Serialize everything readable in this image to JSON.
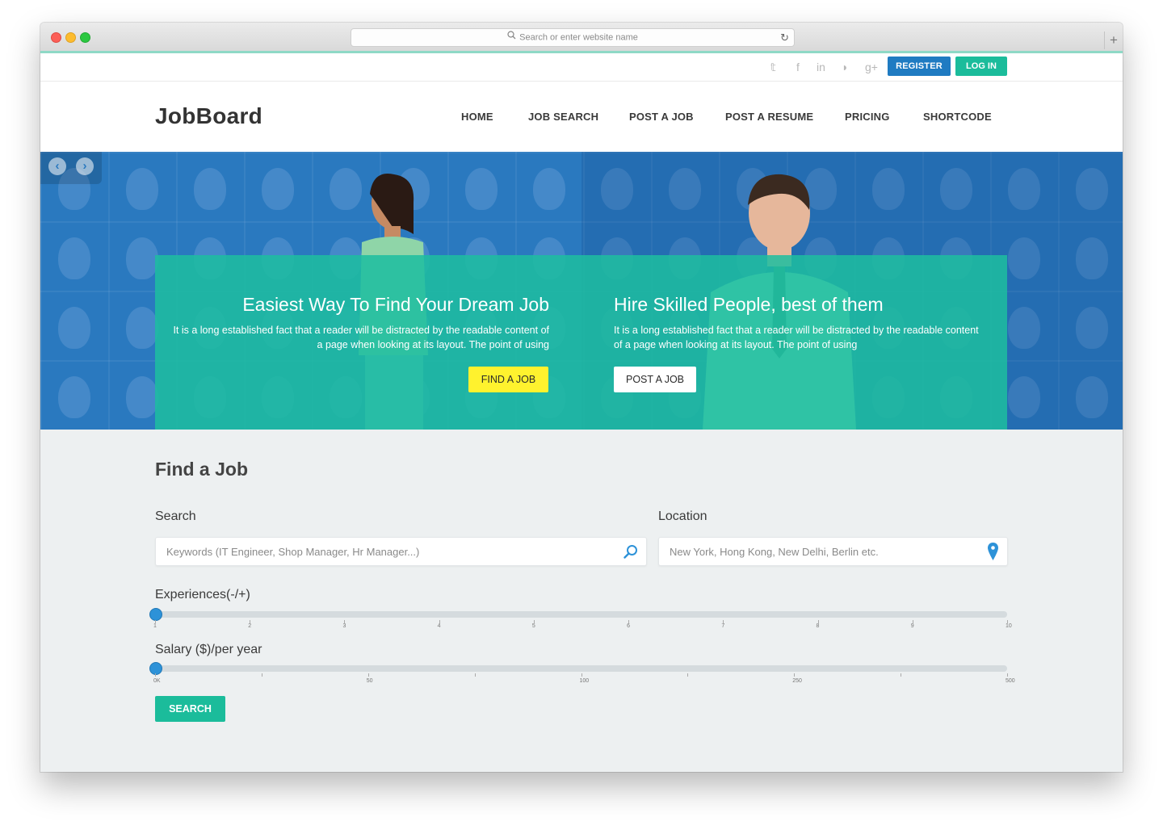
{
  "browser": {
    "url_placeholder": "Search or enter website name",
    "new_tab": "+"
  },
  "topbar": {
    "social_icons": [
      "twitter-icon",
      "facebook-icon",
      "linkedin-icon",
      "rss-icon",
      "google-plus-icon"
    ],
    "social_glyphs": [
      "𝕥",
      "f",
      "in",
      "◗",
      "g+"
    ],
    "register_label": "REGISTER",
    "login_label": "LOG IN"
  },
  "header": {
    "logo": "JobBoard",
    "nav": [
      "HOME",
      "JOB SEARCH",
      "POST A JOB",
      "POST A RESUME",
      "PRICING",
      "SHORTCODE"
    ]
  },
  "hero": {
    "left_title": "Easiest Way To Find Your Dream Job",
    "left_text": "It is a long established fact that a reader will be distracted by the readable content of a page when looking at its layout. The point of using",
    "left_button": "FIND A JOB",
    "right_title": "Hire Skilled People, best of them",
    "right_text": "It is a long established fact that a reader will be distracted by the readable content of a page when looking at its layout. The point of using",
    "right_button": "POST A JOB",
    "prev_arrow": "‹",
    "next_arrow": "›"
  },
  "find_job": {
    "title": "Find a Job",
    "search_label": "Search",
    "search_placeholder": "Keywords (IT Engineer, Shop Manager, Hr Manager...)",
    "location_label": "Location",
    "location_placeholder": "New York, Hong Kong, New Delhi, Berlin etc.",
    "experience_label": "Experiences(-/+)",
    "experience_ticks": [
      "1",
      "2",
      "3",
      "4",
      "5",
      "6",
      "7",
      "8",
      "9",
      "10"
    ],
    "experience_value": 1,
    "salary_label": "Salary ($)/per year",
    "salary_ticks": [
      "0K",
      "",
      "50",
      "",
      "100",
      "",
      "250",
      "",
      "500"
    ],
    "salary_value": "0K",
    "search_button": "SEARCH"
  },
  "colors": {
    "primary_blue": "#1f7bc2",
    "teal": "#1bbc9b",
    "yellow_button": "#fff22e",
    "hero_blue": "#2a79bf"
  }
}
